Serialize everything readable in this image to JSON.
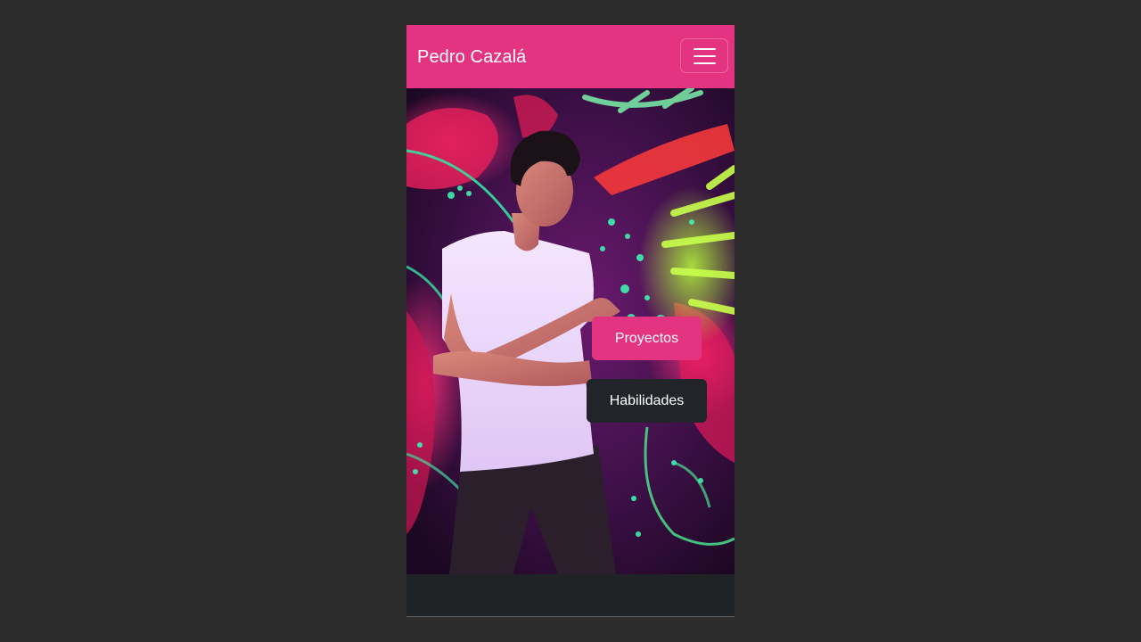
{
  "navbar": {
    "brand": "Pedro Cazalá",
    "menu_icon": "hamburger-menu-icon",
    "bg_color": "#e33381"
  },
  "hero": {
    "image": "photo-of-person-dancing-in-front-of-neon-mural",
    "buttons": {
      "projects_label": "Proyectos",
      "skills_label": "Habilidades"
    }
  },
  "colors": {
    "accent": "#e33381",
    "dark": "#212529",
    "page_bg": "#2c2c2c"
  }
}
